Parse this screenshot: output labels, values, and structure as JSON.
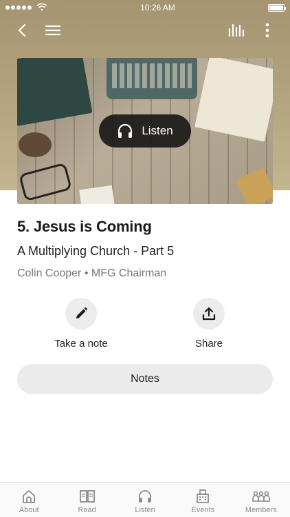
{
  "status_bar": {
    "time": "10:26 AM"
  },
  "nav": {
    "back_icon": "chevron-left-icon",
    "menu_icon": "hamburger-icon",
    "audio_icon": "audio-levels-icon",
    "more_icon": "more-vertical-icon"
  },
  "hero": {
    "listen_label": "Listen",
    "listen_icon": "headphones-icon"
  },
  "sermon": {
    "title": "5. Jesus is Coming",
    "series": "A Multiplying Church - Part 5",
    "speaker": "Colin Cooper",
    "separator": "•",
    "role": "MFG Chairman"
  },
  "actions": {
    "note_label": "Take a note",
    "note_icon": "pencil-icon",
    "share_label": "Share",
    "share_icon": "share-upload-icon"
  },
  "notes": {
    "label": "Notes"
  },
  "tabs": [
    {
      "label": "About",
      "icon": "church-icon"
    },
    {
      "label": "Read",
      "icon": "open-book-icon"
    },
    {
      "label": "Listen",
      "icon": "headphones-icon"
    },
    {
      "label": "Events",
      "icon": "building-icon"
    },
    {
      "label": "Members",
      "icon": "group-icon"
    }
  ],
  "colors": {
    "header_bg": "#b5a57f",
    "pill_dark": "#161616",
    "muted_text": "#777777",
    "button_bg": "#ebebeb",
    "tab_inactive": "#8a8a8a"
  }
}
